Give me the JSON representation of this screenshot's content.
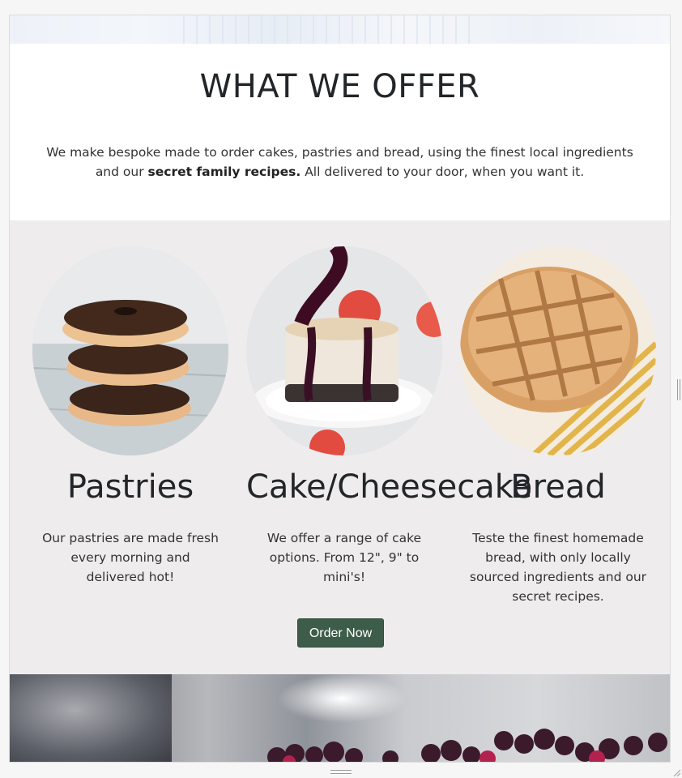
{
  "offer": {
    "title": "WHAT WE OFFER",
    "text_before": "We make bespoke made to order cakes, pastries and bread, using the finest local ingredients and our ",
    "text_bold": "secret family recipes.",
    "text_after": " All delivered to your door, when you want it."
  },
  "products": [
    {
      "title": "Pastries",
      "description": "Our pastries are made fresh every morning and delivered hot!",
      "image": "stacked-chocolate-donuts"
    },
    {
      "title": "Cake/Cheesecake",
      "description": "We offer a range of cake options. From 12\", 9\" to mini's!",
      "image": "cheesecake-with-berry-sauce"
    },
    {
      "title": "Bread",
      "description": "Teste the finest homemade bread, with only locally sourced ingredients and our secret recipes.",
      "image": "lattice-topped-bread"
    }
  ],
  "cta": {
    "label": "Order Now"
  },
  "colors": {
    "section_bg": "#efeced",
    "button_bg": "#3e5c4a",
    "text": "#222629"
  }
}
